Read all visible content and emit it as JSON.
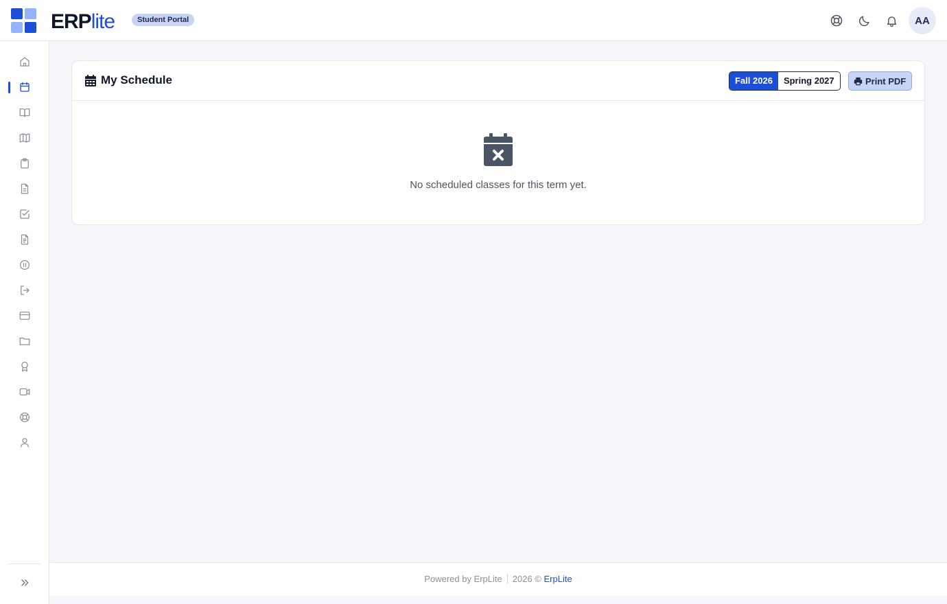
{
  "header": {
    "brand_bold": "ERP",
    "brand_light": "lite",
    "portal_badge": "Student Portal",
    "avatar_initials": "AA",
    "icons": [
      "help-lifebuoy-icon",
      "dark-mode-moon-icon",
      "notifications-bell-icon"
    ]
  },
  "sidebar": {
    "items": [
      {
        "icon": "home-icon",
        "active": false
      },
      {
        "icon": "calendar-icon",
        "active": true
      },
      {
        "icon": "book-open-icon",
        "active": false
      },
      {
        "icon": "map-icon",
        "active": false
      },
      {
        "icon": "clipboard-icon",
        "active": false
      },
      {
        "icon": "document-icon",
        "active": false
      },
      {
        "icon": "checkbox-icon",
        "active": false
      },
      {
        "icon": "document-lines-icon",
        "active": false
      },
      {
        "icon": "pause-circle-icon",
        "active": false
      },
      {
        "icon": "logout-icon",
        "active": false
      },
      {
        "icon": "credit-card-icon",
        "active": false
      },
      {
        "icon": "folder-icon",
        "active": false
      },
      {
        "icon": "award-icon",
        "active": false
      },
      {
        "icon": "video-icon",
        "active": false
      },
      {
        "icon": "lifebuoy-icon",
        "active": false
      },
      {
        "icon": "user-icon",
        "active": false
      }
    ],
    "expand_icon": "chevrons-right-icon"
  },
  "schedule": {
    "title": "My Schedule",
    "terms": [
      {
        "label": "Fall 2026",
        "selected": true
      },
      {
        "label": "Spring 2027",
        "selected": false
      }
    ],
    "print_label": "Print PDF",
    "empty_message": "No scheduled classes for this term yet."
  },
  "footer": {
    "powered_by": "Powered by ErpLite",
    "copyright": "2026 ©",
    "link_text": "ErpLite"
  },
  "colors": {
    "accent": "#1d4ed8",
    "page_background": "#f4f6fa",
    "badge_background": "#c7d4f5"
  }
}
